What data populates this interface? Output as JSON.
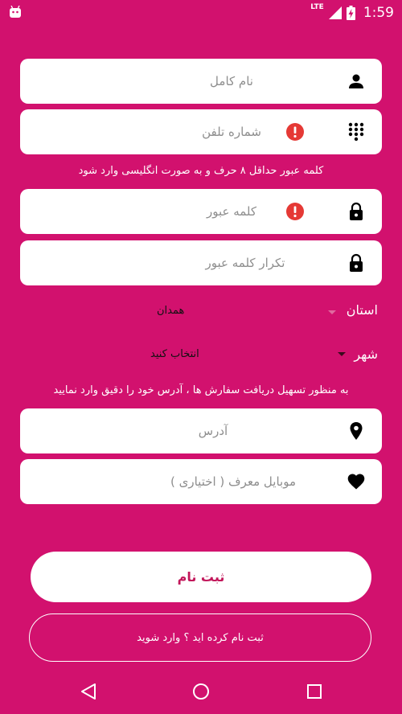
{
  "status_bar": {
    "network": "LTE",
    "time": "1:59"
  },
  "form": {
    "full_name_placeholder": "نام کامل",
    "phone_placeholder": "شماره تلفن",
    "password_hint": "کلمه عبور حداقل ۸ حرف و به صورت انگلیسی وارد شود",
    "password_placeholder": "کلمه عبور",
    "confirm_password_placeholder": "تکرار کلمه عبور",
    "province_label": "استان",
    "province_value": "همدان",
    "city_label": "شهر",
    "city_value": "انتخاب کنید",
    "address_hint": "به منظور تسهیل دریافت سفارش ها ، آدرس خود را دقیق وارد نمایید",
    "address_placeholder": "آدرس",
    "referrer_placeholder": "موبایل معرف ( اختیاری )"
  },
  "actions": {
    "register_label": "ثبت نام",
    "login_label": "ثبت نام کرده اید ؟ وارد شوید"
  },
  "colors": {
    "background": "#d2116e",
    "error": "#e53935",
    "accent_text": "#c2185b"
  }
}
